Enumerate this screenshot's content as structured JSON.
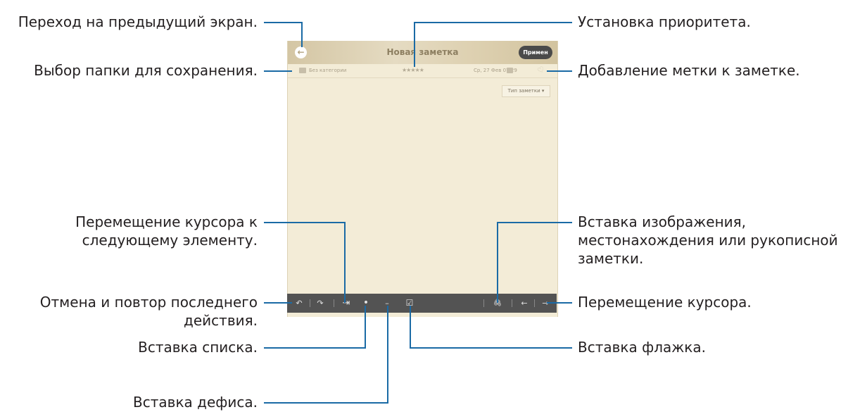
{
  "screen": {
    "title": "Новая заметка",
    "apply_label": "Примен",
    "category": "Без категории",
    "stars": "★★★★★",
    "date": "Ср, 27 Фев 07:29",
    "note_type": "Тип заметки ▾"
  },
  "toolbar": {
    "undo": "↶",
    "redo": "↷",
    "tab": "⇥",
    "bullet": "•",
    "dash": "–",
    "checkbox": "☑",
    "attach": "🖇",
    "left": "←",
    "right": "→"
  },
  "callouts": {
    "back": "Переход на предыдущий экран.",
    "folder": "Выбор папки для сохранения.",
    "next_item_1": "Перемещение курсора к",
    "next_item_2": "следующему элементу.",
    "undo_redo_1": "Отмена и повтор последнего",
    "undo_redo_2": "действия.",
    "list": "Вставка списка.",
    "hyphen": "Вставка дефиса.",
    "priority": "Установка приоритета.",
    "tag": "Добавление метки к заметке.",
    "insert_1": "Вставка изображения,",
    "insert_2": "местонахождения или рукописной",
    "insert_3": "заметки.",
    "cursor": "Перемещение курсора.",
    "checkbox": "Вставка флажка."
  },
  "colors": {
    "callout_line": "#1a6aa5",
    "paper": "#f3ecd7",
    "toolbar": "#535353"
  }
}
